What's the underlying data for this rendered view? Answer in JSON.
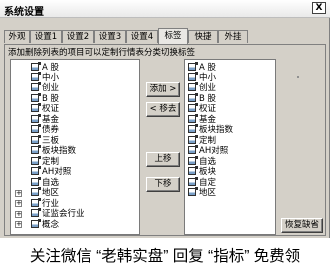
{
  "window": {
    "title": "系统设置",
    "close_label": "X"
  },
  "tabs": [
    {
      "label": "外观",
      "active": false
    },
    {
      "label": "设置1",
      "active": false
    },
    {
      "label": "设置2",
      "active": false
    },
    {
      "label": "设置3",
      "active": false
    },
    {
      "label": "设置4",
      "active": false
    },
    {
      "label": "标签",
      "active": true
    },
    {
      "label": "快捷",
      "active": false
    },
    {
      "label": "外挂",
      "active": false
    }
  ],
  "hint": "添加删除列表的项目可以定制行情表分类切换标签",
  "left_list": [
    {
      "label": "A 股",
      "expander": ""
    },
    {
      "label": "中小",
      "expander": ""
    },
    {
      "label": "创业",
      "expander": ""
    },
    {
      "label": "B 股",
      "expander": ""
    },
    {
      "label": "权证",
      "expander": ""
    },
    {
      "label": "基金",
      "expander": ""
    },
    {
      "label": "债券",
      "expander": ""
    },
    {
      "label": "三板",
      "expander": ""
    },
    {
      "label": "板块指数",
      "expander": ""
    },
    {
      "label": "定制",
      "expander": ""
    },
    {
      "label": "AH对照",
      "expander": ""
    },
    {
      "label": "自选",
      "expander": ""
    },
    {
      "label": "地区",
      "expander": "+"
    },
    {
      "label": "行业",
      "expander": "+"
    },
    {
      "label": "证监会行业",
      "expander": "+"
    },
    {
      "label": "概念",
      "expander": "+"
    }
  ],
  "right_list": [
    "A 股",
    "中小",
    "创业",
    "B 股",
    "权证",
    "基金",
    "板块指数",
    "定制",
    "AH对照",
    "自选",
    "板块",
    "自定",
    "地区"
  ],
  "buttons": {
    "add": "添加 >",
    "remove": "< 移去",
    "up": "上移",
    "down": "下移",
    "restore": "恢复缺省"
  },
  "footer": "关注微信 “老韩实盘” 回复 “指标” 免费领"
}
